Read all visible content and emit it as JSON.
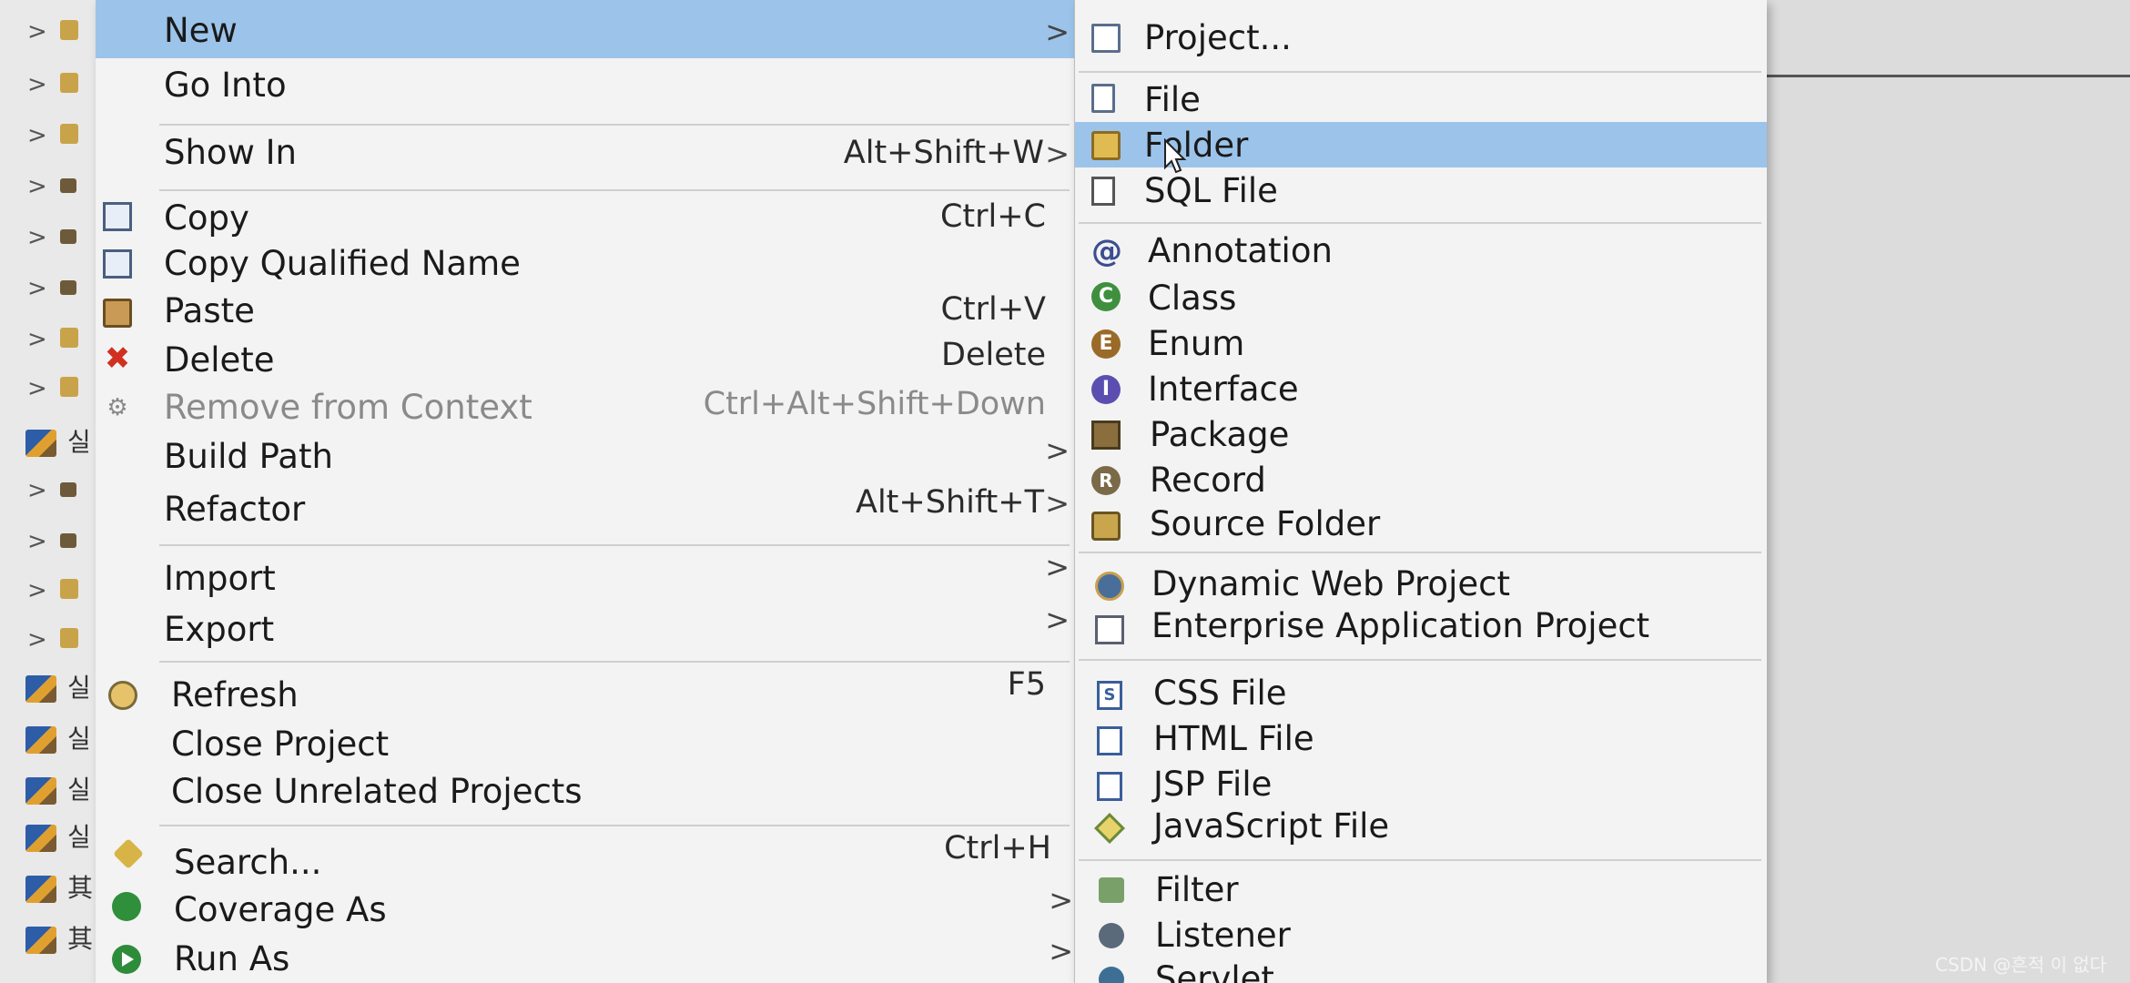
{
  "tree": {
    "rows": [
      {
        "type": "folder"
      },
      {
        "type": "folder"
      },
      {
        "type": "folder"
      },
      {
        "type": "pkg"
      },
      {
        "type": "pkg"
      },
      {
        "type": "pkg"
      },
      {
        "type": "folder"
      },
      {
        "type": "folder"
      },
      {
        "type": "proj",
        "label": "실"
      },
      {
        "type": "pkg"
      },
      {
        "type": "pkg"
      },
      {
        "type": "folder"
      },
      {
        "type": "folder"
      },
      {
        "type": "proj",
        "label": "실"
      },
      {
        "type": "proj",
        "label": "실"
      },
      {
        "type": "proj",
        "label": "실"
      },
      {
        "type": "proj",
        "label": "실"
      },
      {
        "type": "proj",
        "label": "其"
      },
      {
        "type": "proj",
        "label": "其"
      }
    ]
  },
  "context_menu": {
    "items": {
      "new": {
        "label": "New"
      },
      "go_into": {
        "label": "Go Into"
      },
      "show_in": {
        "label": "Show In",
        "accel": "Alt+Shift+W"
      },
      "copy": {
        "label": "Copy",
        "accel": "Ctrl+C"
      },
      "copy_qualified": {
        "label": "Copy Qualified Name"
      },
      "paste": {
        "label": "Paste",
        "accel": "Ctrl+V"
      },
      "delete": {
        "label": "Delete",
        "accel": "Delete"
      },
      "remove_context": {
        "label": "Remove from Context",
        "accel": "Ctrl+Alt+Shift+Down"
      },
      "build_path": {
        "label": "Build Path"
      },
      "refactor": {
        "label": "Refactor",
        "accel": "Alt+Shift+T"
      },
      "import": {
        "label": "Import"
      },
      "export": {
        "label": "Export"
      },
      "refresh": {
        "label": "Refresh",
        "accel": "F5"
      },
      "close_project": {
        "label": "Close Project"
      },
      "close_unrelated": {
        "label": "Close Unrelated Projects"
      },
      "search": {
        "label": "Search...",
        "accel": "Ctrl+H"
      },
      "coverage_as": {
        "label": "Coverage As"
      },
      "run_as": {
        "label": "Run As"
      }
    }
  },
  "new_submenu": {
    "items": {
      "project": {
        "label": "Project..."
      },
      "file": {
        "label": "File"
      },
      "folder": {
        "label": "Folder"
      },
      "sql_file": {
        "label": "SQL File"
      },
      "annotation": {
        "label": "Annotation"
      },
      "class": {
        "label": "Class"
      },
      "enum": {
        "label": "Enum"
      },
      "interface": {
        "label": "Interface"
      },
      "package": {
        "label": "Package"
      },
      "record": {
        "label": "Record"
      },
      "source_folder": {
        "label": "Source Folder"
      },
      "dynamic_web_project": {
        "label": "Dynamic Web Project"
      },
      "enterprise_app_project": {
        "label": "Enterprise Application Project"
      },
      "css_file": {
        "label": "CSS File"
      },
      "html_file": {
        "label": "HTML File"
      },
      "jsp_file": {
        "label": "JSP File"
      },
      "javascript_file": {
        "label": "JavaScript File"
      },
      "filter": {
        "label": "Filter"
      },
      "listener": {
        "label": "Listener"
      },
      "servlet": {
        "label": "Servlet"
      }
    }
  },
  "watermark": "CSDN @흔적 이 없다",
  "colors": {
    "highlight": "#9cc4ea",
    "menu_bg": "#f3f3f3"
  }
}
